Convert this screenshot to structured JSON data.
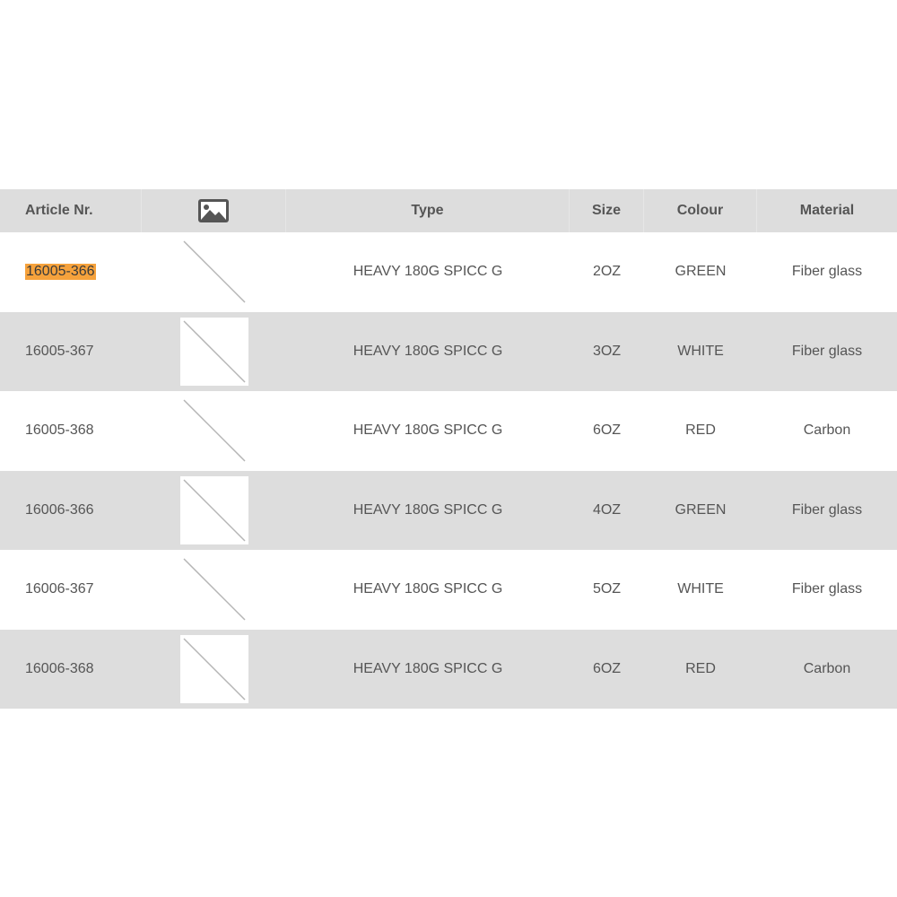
{
  "table": {
    "headers": {
      "article": "Article Nr.",
      "image_icon": "image-icon",
      "type": "Type",
      "size": "Size",
      "colour": "Colour",
      "material": "Material"
    },
    "rows": [
      {
        "article": "16005-366",
        "type": "HEAVY 180G SPICC G",
        "size": "2OZ",
        "colour": "GREEN",
        "material": "Fiber glass",
        "highlighted": true
      },
      {
        "article": "16005-367",
        "type": "HEAVY 180G SPICC G",
        "size": "3OZ",
        "colour": "WHITE",
        "material": "Fiber glass"
      },
      {
        "article": "16005-368",
        "type": "HEAVY 180G SPICC G",
        "size": "6OZ",
        "colour": "RED",
        "material": "Carbon"
      },
      {
        "article": "16006-366",
        "type": "HEAVY 180G SPICC G",
        "size": "4OZ",
        "colour": "GREEN",
        "material": "Fiber glass"
      },
      {
        "article": "16006-367",
        "type": "HEAVY 180G SPICC G",
        "size": "5OZ",
        "colour": "WHITE",
        "material": "Fiber glass"
      },
      {
        "article": "16006-368",
        "type": "HEAVY 180G SPICC G",
        "size": "6OZ",
        "colour": "RED",
        "material": "Carbon"
      }
    ]
  },
  "colors": {
    "header_bg": "#dddddd",
    "stripe_bg": "#dddddd",
    "highlight": "#f6a23c",
    "text": "#555555"
  }
}
